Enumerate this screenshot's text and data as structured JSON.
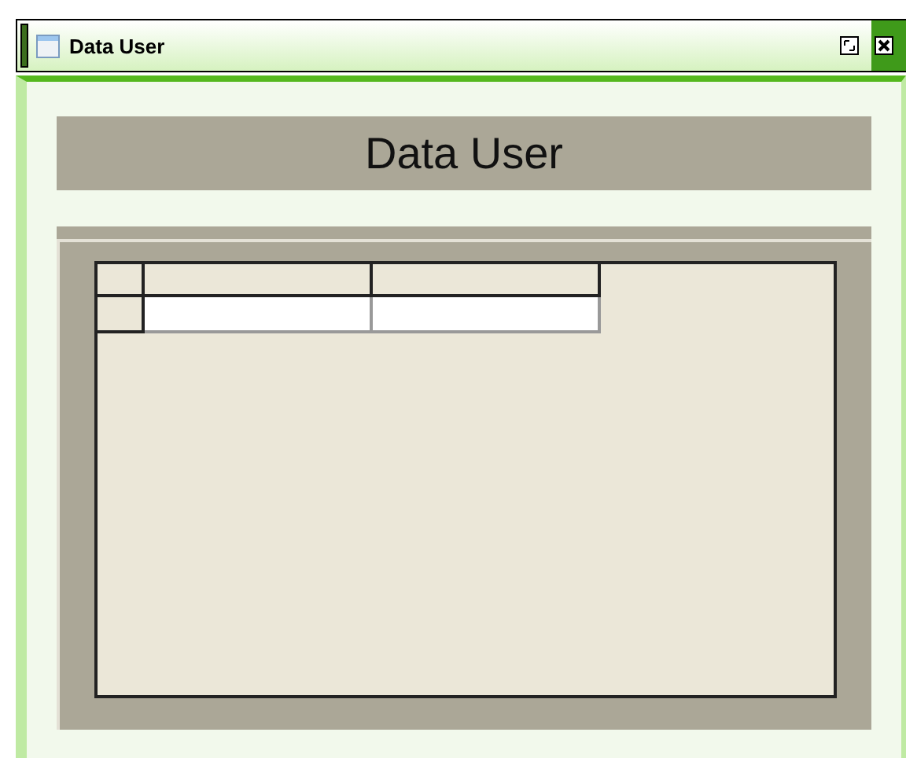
{
  "window": {
    "title": "Data User"
  },
  "heading": "Data User"
}
